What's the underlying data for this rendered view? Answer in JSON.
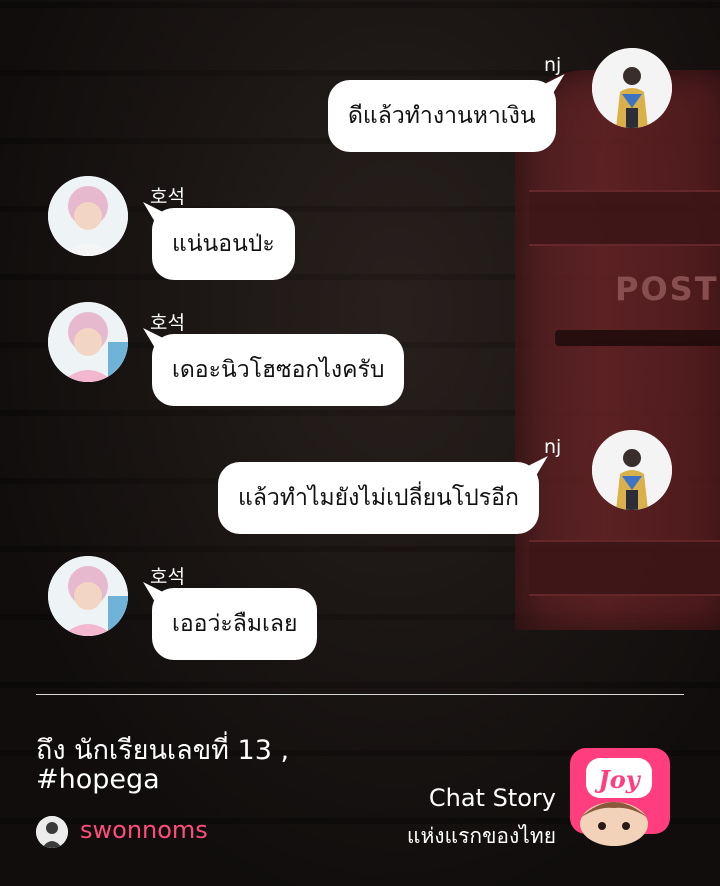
{
  "messages": [
    {
      "sender": "nj",
      "side": "right",
      "text": "ดีแล้วทำงานหาเงิน"
    },
    {
      "sender": "호석",
      "side": "left",
      "text": "แน่นอนป่ะ"
    },
    {
      "sender": "호석",
      "side": "left",
      "text": "เดอะนิวโฮซอกไงครับ"
    },
    {
      "sender": "nj",
      "side": "right",
      "text": "แล้วทำไมยังไม่เปลี่ยนโปรอีก"
    },
    {
      "sender": "호석",
      "side": "left",
      "text": "เออว่ะลืมเลย"
    }
  ],
  "background": {
    "postbox_text": "POST"
  },
  "footer": {
    "caption_line1": "ถึง นักเรียนเลขที่ 13 ,",
    "caption_line2": "#hopega",
    "author": "swonnoms",
    "brand_line1": "Chat Story",
    "brand_line2": "แห่งแรกของไทย",
    "badge_text": "Joy"
  },
  "colors": {
    "author": "#ff4d7a",
    "badge": "#ff3d7f",
    "bubble": "#ffffff"
  }
}
